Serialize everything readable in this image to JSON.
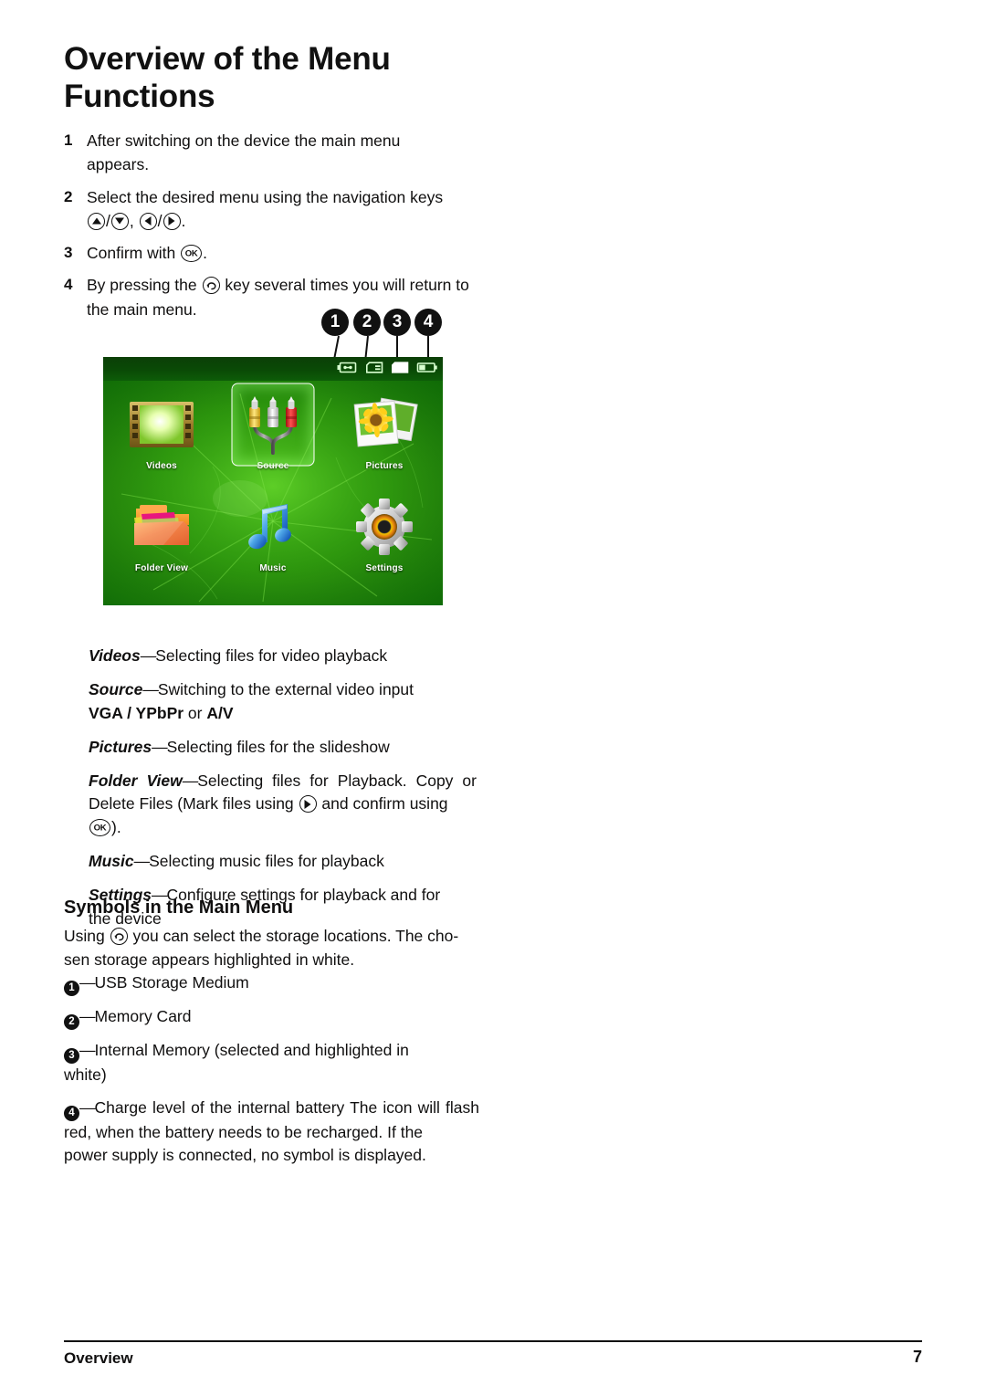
{
  "document": {
    "title_lines": [
      "Overview of the Menu",
      "Functions"
    ]
  },
  "steps": [
    {
      "num": "1",
      "text_before": "After switching on the device the main menu",
      "text_after": "appears."
    },
    {
      "num": "2",
      "text_before": "Select the desired menu using the navigation keys",
      "text_after": ""
    },
    {
      "num": "3",
      "text_before": "Confirm with",
      "text_after": "."
    },
    {
      "num": "4",
      "text_before": "By pressing the",
      "text_mid": "key several times you will return",
      "text_after": "to the main menu."
    }
  ],
  "step_icons": {
    "up": "nav-up-icon",
    "down": "nav-down-icon",
    "left": "nav-left-icon",
    "right": "nav-right-icon",
    "ok": "OK",
    "back": "back-icon",
    "slash": "/",
    "comma": ", ",
    "period": "."
  },
  "callouts": [
    {
      "number": "1"
    },
    {
      "number": "2"
    },
    {
      "number": "3"
    },
    {
      "number": "4"
    }
  ],
  "screenshot": {
    "statusbar_icons": [
      {
        "name": "usb-storage-icon",
        "state": "outline"
      },
      {
        "name": "memory-card-icon",
        "state": "outline"
      },
      {
        "name": "internal-memory-icon",
        "state": "filled-white-selected"
      },
      {
        "name": "battery-icon",
        "state": "partial-charge"
      }
    ],
    "menu_items": [
      {
        "label": "Videos",
        "icon": "film-strip-icon",
        "selected": false
      },
      {
        "label": "Source",
        "icon": "rca-cables-icon",
        "selected": true
      },
      {
        "label": "Pictures",
        "icon": "photo-stack-icon",
        "selected": false
      },
      {
        "label": "Folder View",
        "icon": "folder-icon",
        "selected": false
      },
      {
        "label": "Music",
        "icon": "music-note-icon",
        "selected": false
      },
      {
        "label": "Settings",
        "icon": "gear-icon",
        "selected": false
      }
    ]
  },
  "definitions": [
    {
      "term": "Videos",
      "dash": "—",
      "body": "Selecting files for video playback",
      "body2": "",
      "bold_tail": ""
    },
    {
      "term": "Source",
      "dash": "—",
      "body": "Switching to the external video input",
      "body2": "",
      "bold_tail_vga": "VGA / YPbPr",
      "bold_tail_or": " or ",
      "bold_tail_av": "A/V"
    },
    {
      "term": "Pictures",
      "dash": "—",
      "body": "Selecting files for the slideshow",
      "body2": ""
    },
    {
      "term": "Folder View",
      "dash": "—",
      "body": "Selecting files for Playback. Copy or Delete Files (Mark files using",
      "body_mid": "and confirm using",
      "body_end": ")."
    },
    {
      "term": "Music",
      "dash": "—",
      "body": "Selecting music files for playback",
      "body2": ""
    },
    {
      "term": "Settings",
      "dash": "—",
      "body": "Configure settings for playback and for",
      "body2": "the device"
    }
  ],
  "subsection": {
    "heading": "Symbols in the Main Menu",
    "using_before": "Using",
    "using_after": "you can select the storage locations. The cho-",
    "using_line2": "sen storage appears highlighted in white."
  },
  "symbol_list": [
    {
      "number": "1",
      "dash": "—",
      "text": "USB Storage Medium",
      "text2": ""
    },
    {
      "number": "2",
      "dash": "—",
      "text": "Memory Card",
      "text2": ""
    },
    {
      "number": "3",
      "dash": "—",
      "text": "Internal Memory (selected and highlighted in",
      "text2": "white)"
    },
    {
      "number": "4",
      "dash": "—",
      "text": "Charge level of the internal battery The icon will flash red, when the battery needs to be recharged. If the",
      "text2": "power supply is connected, no symbol is displayed."
    }
  ],
  "footer": {
    "section": "Overview",
    "page": "7"
  },
  "colors": {
    "text": "#100f0f",
    "leaf_green": "#2a8f0c",
    "selection_white": "#ffffff"
  }
}
